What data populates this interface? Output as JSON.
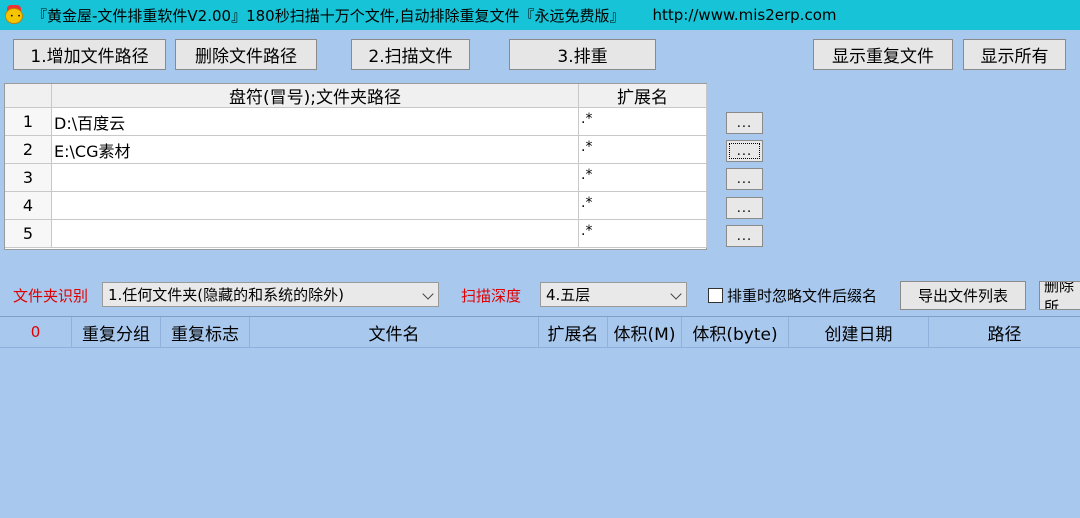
{
  "window": {
    "title": "『黄金屋-文件排重软件V2.00』180秒扫描十万个文件,自动排除重复文件『永远免费版』",
    "url": "http://www.mis2erp.com",
    "icon": "app-icon"
  },
  "toolbar": {
    "add_path": "1.增加文件路径",
    "delete_path": "删除文件路径",
    "scan": "2.扫描文件",
    "dedupe": "3.排重",
    "show_duplicates": "显示重复文件",
    "show_all": "显示所有"
  },
  "path_grid": {
    "headers": {
      "path": "盘符(冒号);文件夹路径",
      "ext": "扩展名"
    },
    "rows": [
      {
        "num": "1",
        "path": "D:\\百度云",
        "ext": ".*"
      },
      {
        "num": "2",
        "path": "E:\\CG素材",
        "ext": ".*"
      },
      {
        "num": "3",
        "path": "",
        "ext": ".*"
      },
      {
        "num": "4",
        "path": "",
        "ext": ".*"
      },
      {
        "num": "5",
        "path": "",
        "ext": ".*"
      }
    ],
    "browse_label": "..."
  },
  "options": {
    "folder_label": "文件夹识别",
    "folder_value": "1.任何文件夹(隐藏的和系统的除外)",
    "depth_label": "扫描深度",
    "depth_value": "4.五层",
    "ignore_suffix_label": "排重时忽略文件后缀名",
    "ignore_suffix_checked": false,
    "export_label": "导出文件列表",
    "delete_label": "删除所"
  },
  "results": {
    "count": "0",
    "columns": [
      "重复分组",
      "重复标志",
      "文件名",
      "扩展名",
      "体积(M)",
      "体积(byte)",
      "创建日期",
      "路径"
    ]
  },
  "colors": {
    "titlebar": "#17c3d6",
    "background": "#a9c8ee",
    "label_red": "#e00000"
  }
}
